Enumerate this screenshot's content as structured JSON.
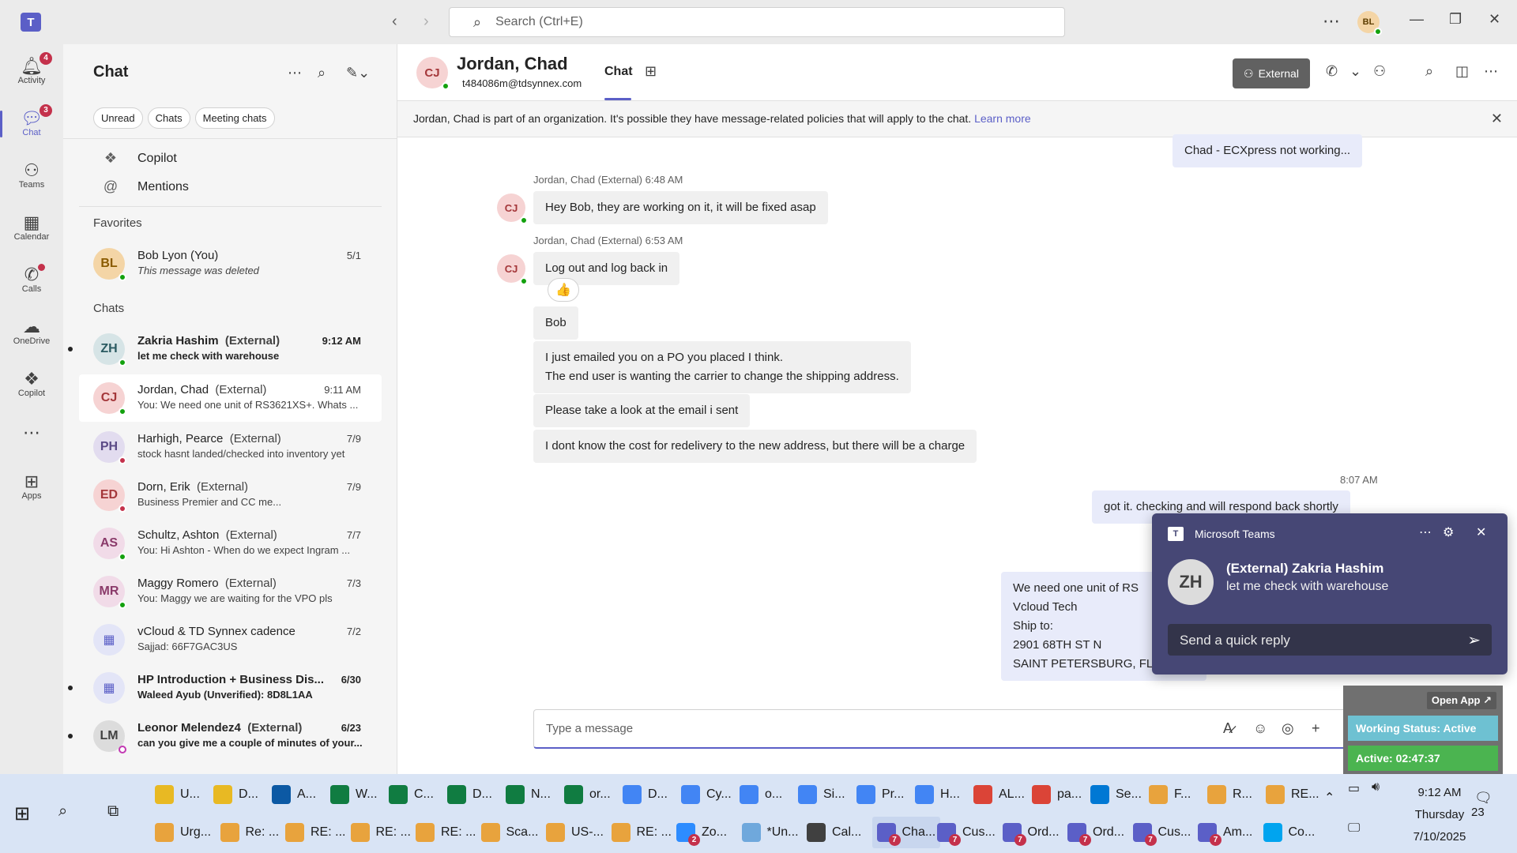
{
  "titlebar": {
    "search_placeholder": "Search (Ctrl+E)",
    "user_initials": "BL"
  },
  "rail": {
    "items": [
      {
        "label": "Activity",
        "badge": "4"
      },
      {
        "label": "Chat",
        "badge": "3"
      },
      {
        "label": "Teams"
      },
      {
        "label": "Calendar"
      },
      {
        "label": "Calls"
      },
      {
        "label": "OneDrive"
      },
      {
        "label": "Copilot"
      },
      {
        "label": "Apps"
      }
    ]
  },
  "chatlist": {
    "title": "Chat",
    "filters": [
      "Unread",
      "Chats",
      "Meeting chats"
    ],
    "nav": [
      {
        "label": "Copilot"
      },
      {
        "label": "Mentions"
      }
    ],
    "favorites_label": "Favorites",
    "chats_label": "Chats",
    "favorites": [
      {
        "initials": "BL",
        "name": "Bob Lyon (You)",
        "preview": "This message was deleted",
        "time": "5/1"
      }
    ],
    "chats": [
      {
        "initials": "ZH",
        "name": "Zakria Hashim",
        "ext": "(External)",
        "preview": "let me check with warehouse",
        "time": "9:12 AM"
      },
      {
        "initials": "CJ",
        "name": "Jordan, Chad",
        "ext": "(External)",
        "preview": "You: We need one unit of RS3621XS+. Whats ...",
        "time": "9:11 AM"
      },
      {
        "initials": "PH",
        "name": "Harhigh, Pearce",
        "ext": "(External)",
        "preview": "stock hasnt landed/checked into inventory yet",
        "time": "7/9"
      },
      {
        "initials": "ED",
        "name": "Dorn, Erik",
        "ext": "(External)",
        "preview": "Business Premier and CC me...",
        "time": "7/9"
      },
      {
        "initials": "AS",
        "name": "Schultz, Ashton",
        "ext": "(External)",
        "preview": "You: Hi Ashton -  When do we expect Ingram ...",
        "time": "7/7"
      },
      {
        "initials": "MR",
        "name": "Maggy Romero",
        "ext": "(External)",
        "preview": "You: Maggy we are waiting for the VPO pls",
        "time": "7/3"
      },
      {
        "initials": "",
        "name": "vCloud & TD Synnex cadence",
        "ext": "",
        "preview": "Sajjad: 66F7GAC3US",
        "time": "7/2"
      },
      {
        "initials": "",
        "name": "HP Introduction + Business Dis...",
        "ext": "",
        "preview": "Waleed Ayub (Unverified): 8D8L1AA",
        "time": "6/30"
      },
      {
        "initials": "LM",
        "name": "Leonor Melendez4",
        "ext": "(External)",
        "preview": "can you give me a couple of minutes of your...",
        "time": "6/23"
      }
    ]
  },
  "chat": {
    "avatar_initials": "CJ",
    "name": "Jordan, Chad",
    "email": "t484086m@tdsynnex.com",
    "tab_label": "Chat",
    "external_label": "External",
    "banner_text": "Jordan, Chad is part of an organization. It's possible they have message-related policies that will apply to the chat.",
    "banner_link": "Learn more",
    "messages": {
      "top_quote": "Chad -  ECXpress not working...",
      "m1_meta": "Jordan, Chad (External)   6:48 AM",
      "m1_text": "Hey Bob, they are working on it, it will be fixed asap",
      "m2_meta": "Jordan, Chad (External)   6:53 AM",
      "m2_text": "Log out and log back in",
      "reaction": "👍",
      "m3_text": "Bob",
      "m4_line1": "I just emailed you on a PO you placed I think.",
      "m4_line2": "The end user is wanting the carrier to change the shipping address.",
      "m5_text": "Please take a look at the email i sent",
      "m6_text": "I dont know the cost for redelivery to the new address, but there will be a charge",
      "mine_time": "8:07 AM",
      "mine1_text": "got it. checking and will respond back shortly",
      "mine2_lines": [
        "We need one unit of RS",
        "Vcloud Tech",
        "Ship to:",
        "2901 68TH ST N",
        "SAINT PETERSBURG, FL"
      ]
    },
    "composer_placeholder": "Type a message"
  },
  "toast": {
    "app_name": "Microsoft Teams",
    "avatar_initials": "ZH",
    "title": "(External) Zakria Hashim",
    "body": "let me check with warehouse",
    "reply_placeholder": "Send a quick reply"
  },
  "working_status": {
    "open_app": "Open App ↗",
    "status": "Working Status: Active",
    "active": "Active: 02:47:37"
  },
  "taskbar": {
    "row1": [
      {
        "label": "U...",
        "color": "#e8b923"
      },
      {
        "label": "D...",
        "color": "#e8b923"
      },
      {
        "label": "A...",
        "color": "#0c59a4"
      },
      {
        "label": "W...",
        "color": "#107c41"
      },
      {
        "label": "C...",
        "color": "#107c41"
      },
      {
        "label": "D...",
        "color": "#107c41"
      },
      {
        "label": "N...",
        "color": "#107c41"
      },
      {
        "label": "or...",
        "color": "#107c41"
      },
      {
        "label": "D...",
        "color": "#4285f4"
      },
      {
        "label": "Cy...",
        "color": "#4285f4"
      },
      {
        "label": "o...",
        "color": "#4285f4"
      },
      {
        "label": "Si...",
        "color": "#4285f4"
      },
      {
        "label": "Pr...",
        "color": "#4285f4"
      },
      {
        "label": "H...",
        "color": "#4285f4"
      },
      {
        "label": "AL...",
        "color": "#db4437"
      },
      {
        "label": "pa...",
        "color": "#db4437"
      },
      {
        "label": "Se...",
        "color": "#0078d4"
      },
      {
        "label": "F...",
        "color": "#e8a33d"
      },
      {
        "label": "R...",
        "color": "#e8a33d"
      },
      {
        "label": "RE...",
        "color": "#e8a33d"
      }
    ],
    "row2": [
      {
        "label": "Urg...",
        "color": "#e8a33d"
      },
      {
        "label": "Re: ...",
        "color": "#e8a33d"
      },
      {
        "label": "RE: ...",
        "color": "#e8a33d"
      },
      {
        "label": "RE: ...",
        "color": "#e8a33d"
      },
      {
        "label": "RE: ...",
        "color": "#e8a33d"
      },
      {
        "label": "Sca...",
        "color": "#e8a33d"
      },
      {
        "label": "US-...",
        "color": "#e8a33d"
      },
      {
        "label": "RE: ...",
        "color": "#e8a33d"
      },
      {
        "label": "Zo...",
        "color": "#2d8cff",
        "badge": "2"
      },
      {
        "label": "*Un...",
        "color": "#6fa8dc"
      },
      {
        "label": "Cal...",
        "color": "#404040"
      },
      {
        "label": "Cha...",
        "color": "#5b5fc7",
        "badge": "7"
      },
      {
        "label": "Cus...",
        "color": "#5b5fc7",
        "badge": "7"
      },
      {
        "label": "Ord...",
        "color": "#5b5fc7",
        "badge": "7"
      },
      {
        "label": "Ord...",
        "color": "#5b5fc7",
        "badge": "7"
      },
      {
        "label": "Cus...",
        "color": "#5b5fc7",
        "badge": "7"
      },
      {
        "label": "Am...",
        "color": "#5b5fc7",
        "badge": "7"
      },
      {
        "label": "Co...",
        "color": "#00a4ef"
      }
    ],
    "time": "9:12 AM",
    "day": "Thursday",
    "date": "7/10/2025",
    "notifications": "23"
  }
}
